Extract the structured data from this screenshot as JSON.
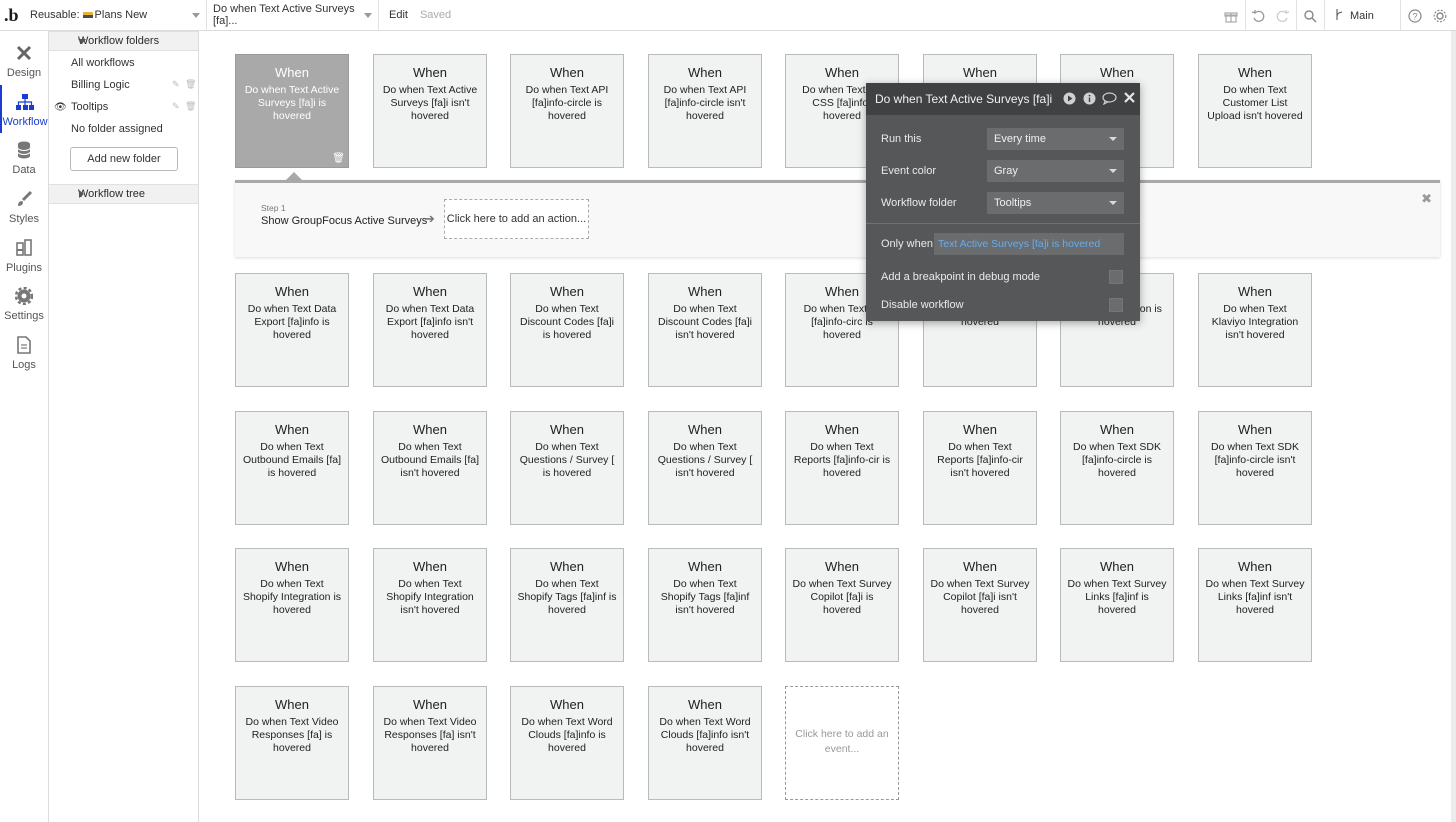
{
  "topbar": {
    "logo": ".b",
    "page_prefix": "Reusable:",
    "page_name": "Plans New",
    "workflow_select": "Do when Text Active Surveys [fa]...",
    "edit_label": "Edit",
    "saved_label": "Saved",
    "branch_label": "Main"
  },
  "sidebar": {
    "items": [
      {
        "label": "Design",
        "icon": "design-icon"
      },
      {
        "label": "Workflow",
        "icon": "workflow-icon"
      },
      {
        "label": "Data",
        "icon": "data-icon"
      },
      {
        "label": "Styles",
        "icon": "styles-icon"
      },
      {
        "label": "Plugins",
        "icon": "plugins-icon"
      },
      {
        "label": "Settings",
        "icon": "gear-icon"
      },
      {
        "label": "Logs",
        "icon": "logs-icon"
      }
    ]
  },
  "folders": {
    "header": "Workflow folders",
    "items": [
      "All workflows",
      "Billing Logic",
      "Tooltips",
      "No folder assigned"
    ],
    "add_button": "Add new folder",
    "tree_header": "Workflow tree"
  },
  "cards": {
    "when_label": "When",
    "row1": [
      "Do when Text Active Surveys [fa]i is hovered",
      "Do when Text Active Surveys [fa]i isn't hovered",
      "Do when Text API [fa]info-circle is hovered",
      "Do when Text API [fa]info-circle isn't hovered",
      "Do when Text Cu CSS [fa]info- hovered",
      "",
      "xt pload",
      "Do when Text Customer List Upload isn't hovered"
    ],
    "row2": [
      "Do when Text Data Export [fa]info is hovered",
      "Do when Text Data Export [fa]info isn't hovered",
      "Do when Text Discount Codes [fa]i is hovered",
      "Do when Text Discount Codes [fa]i isn't hovered",
      "Do when Text Er [fa]info-circ is hovered",
      "[fa]info-circ isn't hovered",
      "laviyo Integration is hovered",
      "Do when Text Klaviyo Integration isn't hovered"
    ],
    "row3": [
      "Do when Text Outbound Emails [fa] is hovered",
      "Do when Text Outbound Emails [fa] isn't hovered",
      "Do when Text Questions / Survey [ is hovered",
      "Do when Text Questions / Survey [ isn't hovered",
      "Do when Text Reports [fa]info-cir is hovered",
      "Do when Text Reports [fa]info-cir isn't hovered",
      "Do when Text SDK [fa]info-circle is hovered",
      "Do when Text SDK [fa]info-circle isn't hovered"
    ],
    "row4": [
      "Do when Text Shopify Integration is hovered",
      "Do when Text Shopify Integration isn't hovered",
      "Do when Text Shopify Tags [fa]inf is hovered",
      "Do when Text Shopify Tags [fa]inf isn't hovered",
      "Do when Text Survey Copilot [fa]i is hovered",
      "Do when Text Survey Copilot [fa]i isn't hovered",
      "Do when Text Survey Links [fa]inf is hovered",
      "Do when Text Survey Links [fa]inf isn't hovered"
    ],
    "row5": [
      "Do when Text Video Responses [fa] is hovered",
      "Do when Text Video Responses [fa] isn't hovered",
      "Do when Text Word Clouds [fa]info is hovered",
      "Do when Text Word Clouds [fa]info isn't hovered"
    ],
    "add_event": "Click here to add an event..."
  },
  "action_strip": {
    "step_label": "Step 1",
    "step_title": "Show GroupFocus Active Surveys",
    "add_action": "Click here to add an action..."
  },
  "props": {
    "title": "Do when Text Active Surveys [fa]i",
    "run_this_label": "Run this",
    "run_this_value": "Every time",
    "event_color_label": "Event color",
    "event_color_value": "Gray",
    "folder_label": "Workflow folder",
    "folder_value": "Tooltips",
    "only_when_label": "Only when",
    "only_when_value": "Text Active Surveys [fa]i is hovered",
    "breakpoint_label": "Add a breakpoint in debug mode",
    "disable_label": "Disable workflow"
  },
  "colors": {
    "accent": "#1a3dcf",
    "selected_card": "#a9a9a9",
    "card_bg": "#f1f2f2",
    "popup_bg": "#555759",
    "condition_text": "#62aef5"
  }
}
